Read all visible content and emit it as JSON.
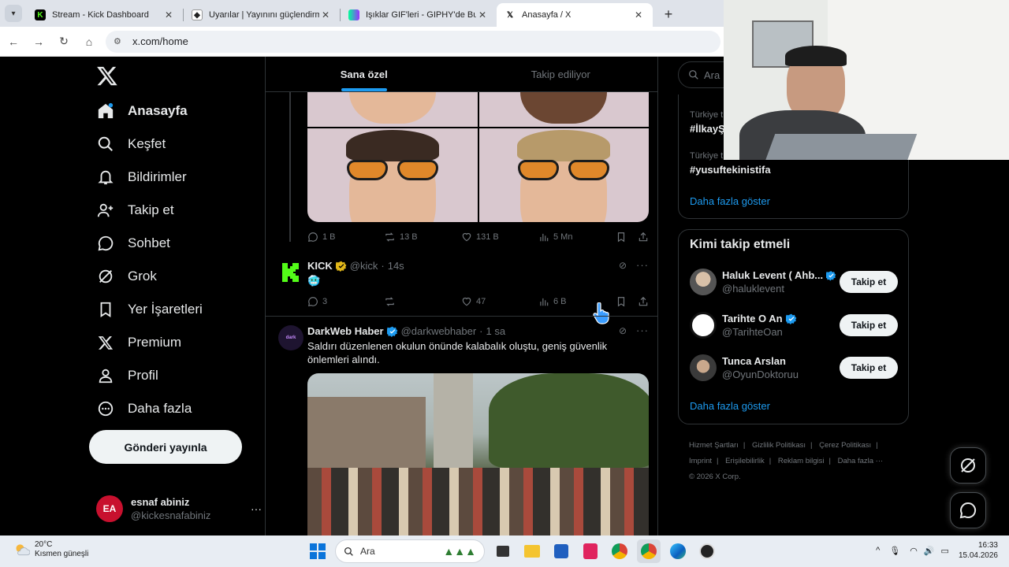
{
  "browser": {
    "tabs": [
      {
        "label": "Stream - Kick Dashboard",
        "icon": "kick-icon",
        "active": false
      },
      {
        "label": "Uyarılar | Yayınını güçlendirmek",
        "icon": "streamelements-icon",
        "active": false
      },
      {
        "label": "Işıklar GIF'leri - GIPHY'de Bul ve",
        "icon": "giphy-icon",
        "active": false
      },
      {
        "label": "Anasayfa / X",
        "icon": "x-icon",
        "active": true
      }
    ],
    "url": "x.com/home"
  },
  "sidebar": {
    "items": [
      {
        "label": "Anasayfa",
        "icon": "home-icon"
      },
      {
        "label": "Keşfet",
        "icon": "search-icon"
      },
      {
        "label": "Bildirimler",
        "icon": "bell-icon"
      },
      {
        "label": "Takip et",
        "icon": "follow-icon"
      },
      {
        "label": "Sohbet",
        "icon": "chat-icon"
      },
      {
        "label": "Grok",
        "icon": "grok-icon"
      },
      {
        "label": "Yer İşaretleri",
        "icon": "bookmark-icon"
      },
      {
        "label": "Premium",
        "icon": "x-icon"
      },
      {
        "label": "Profil",
        "icon": "profile-icon"
      },
      {
        "label": "Daha fazla",
        "icon": "more-circle-icon"
      }
    ],
    "post_button": "Gönderi yayınla",
    "account": {
      "name": "esnaf abiniz",
      "handle": "@kickesnafabiniz"
    }
  },
  "feed": {
    "tabs": [
      "Sana özel",
      "Takip ediliyor"
    ],
    "tweet1_actions": {
      "replies": "1 B",
      "reposts": "13 B",
      "likes": "131 B",
      "views": "5 Mn"
    },
    "tweet2": {
      "name": "KICK",
      "handle": "@kick",
      "time": "14s",
      "text": "🥶",
      "actions": {
        "replies": "3",
        "reposts": "",
        "likes": "47",
        "views": "6 B"
      }
    },
    "tweet3": {
      "name": "DarkWeb Haber",
      "handle": "@darkwebhaber",
      "time": "1 sa",
      "text": "Saldırı düzenlenen okulun önünde kalabalık oluştu, geniş güvenlik önlemleri alındı."
    }
  },
  "right": {
    "search_placeholder": "Ara",
    "trends": [
      {
        "category": "Türkiye t",
        "tag": "#İlkayŞ"
      },
      {
        "category": "Türkiye t",
        "tag": "#yusuftekinistifa"
      }
    ],
    "trends_show_more": "Daha fazla göster",
    "who_to_follow": {
      "title": "Kimi takip etmeli",
      "users": [
        {
          "name": "Haluk Levent ( Ahb...",
          "handle": "@haluklevent",
          "button": "Takip et"
        },
        {
          "name": "Tarihte O An",
          "handle": "@TarihteOan",
          "button": "Takip et"
        },
        {
          "name": "Tunca Arslan",
          "handle": "@OyunDoktoruu",
          "button": "Takip et"
        }
      ],
      "show_more": "Daha fazla göster"
    },
    "footer": [
      "Hizmet Şartları",
      "|",
      "Gizlilik Politikası",
      "|",
      "Çerez Politikası",
      "|",
      "Imprint",
      "|",
      "Erişilebilirlik",
      "|",
      "Reklam bilgisi",
      "|",
      "Daha fazla ···",
      "© 2026 X Corp."
    ]
  },
  "taskbar": {
    "weather_temp": "20°C",
    "weather_desc": "Kısmen güneşli",
    "search_placeholder": "Ara",
    "time": "16:33",
    "date": "15.04.2026"
  },
  "colors": {
    "accent": "#1d9bf0",
    "verified": "#1d9bf0",
    "kick_green": "#53fc18",
    "business_gold": "#e2b719"
  }
}
